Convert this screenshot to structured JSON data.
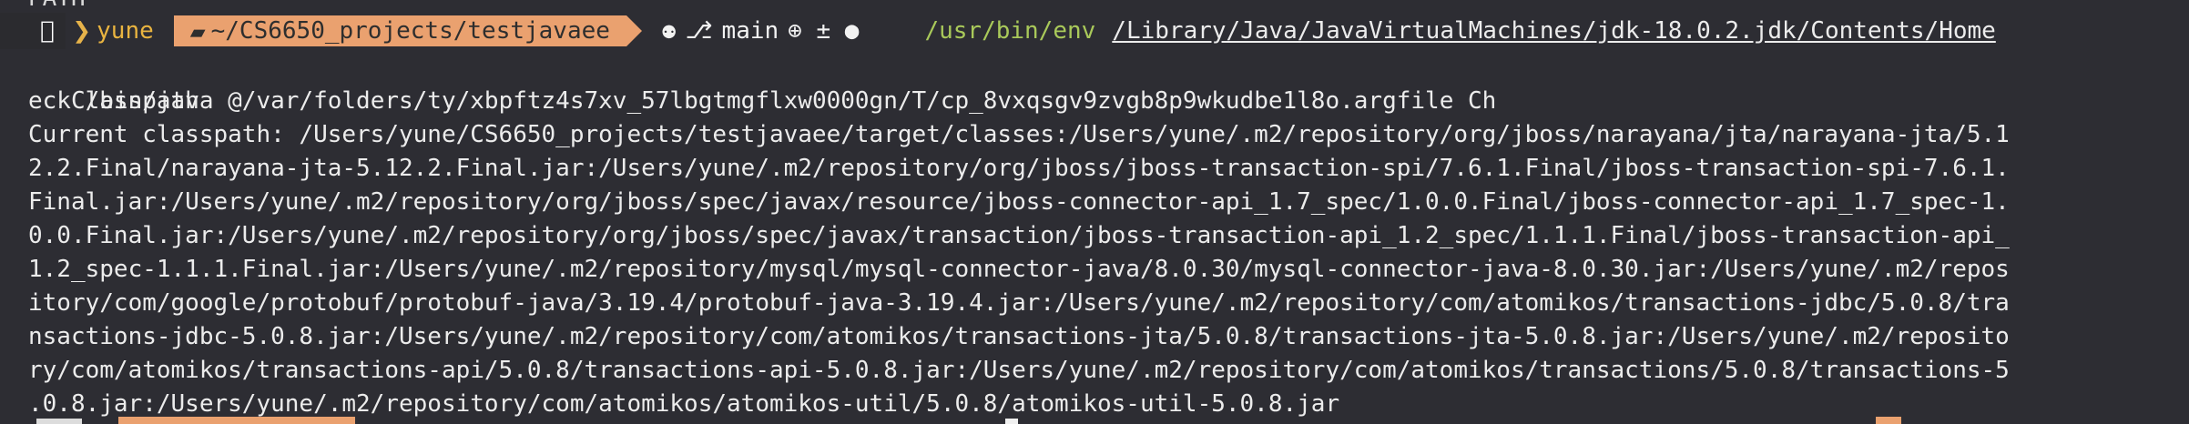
{
  "window": {
    "top_clipped_text": "PATH"
  },
  "prompt": {
    "user": "yune",
    "directory": "~/CS6650_projects/testjavaee",
    "git_branch": "main",
    "git_status": "⊕ ± ●",
    "command_prefix": "/usr/bin/env",
    "java_path": "/Library/Java/JavaVirtualMachines/jdk-18.0.2.jdk/Contents/Home"
  },
  "output": {
    "line2": "/bin/java @/var/folders/ty/xbpftz4s7xv_57lbgtmgflxw0000gn/T/cp_8vxqsgv9zvgb8p9wkudbe1l8o.argfile Ch",
    "line3": "eckClasspath",
    "line4": "Current classpath: /Users/yune/CS6650_projects/testjavaee/target/classes:/Users/yune/.m2/repository/org/jboss/narayana/jta/narayana-jta/5.1",
    "line5": "2.2.Final/narayana-jta-5.12.2.Final.jar:/Users/yune/.m2/repository/org/jboss/jboss-transaction-spi/7.6.1.Final/jboss-transaction-spi-7.6.1.",
    "line6": "Final.jar:/Users/yune/.m2/repository/org/jboss/spec/javax/resource/jboss-connector-api_1.7_spec/1.0.0.Final/jboss-connector-api_1.7_spec-1.",
    "line7": "0.0.Final.jar:/Users/yune/.m2/repository/org/jboss/spec/javax/transaction/jboss-transaction-api_1.2_spec/1.1.1.Final/jboss-transaction-api_",
    "line8": "1.2_spec-1.1.1.Final.jar:/Users/yune/.m2/repository/mysql/mysql-connector-java/8.0.30/mysql-connector-java-8.0.30.jar:/Users/yune/.m2/repos",
    "line9": "itory/com/google/protobuf/protobuf-java/3.19.4/protobuf-java-3.19.4.jar:/Users/yune/.m2/repository/com/atomikos/transactions-jdbc/5.0.8/tra",
    "line10": "nsactions-jdbc-5.0.8.jar:/Users/yune/.m2/repository/com/atomikos/transactions-jta/5.0.8/transactions-jta-5.0.8.jar:/Users/yune/.m2/reposito",
    "line11": "ry/com/atomikos/transactions-api/5.0.8/transactions-api-5.0.8.jar:/Users/yune/.m2/repository/com/atomikos/transactions/5.0.8/transactions-5",
    "line12": ".0.8.jar:/Users/yune/.m2/repository/com/atomikos/atomikos-util/5.0.8/atomikos-util-5.0.8.jar"
  },
  "icons": {
    "os": "apple-icon",
    "folder": "folder-icon",
    "github": "github-cat-icon",
    "branch": "git-branch-icon"
  },
  "colors": {
    "background": "#2d2d33",
    "user": "#e9b440",
    "directory_segment": "#eaa16f",
    "command": "#a9c95a",
    "text": "#ececec"
  }
}
